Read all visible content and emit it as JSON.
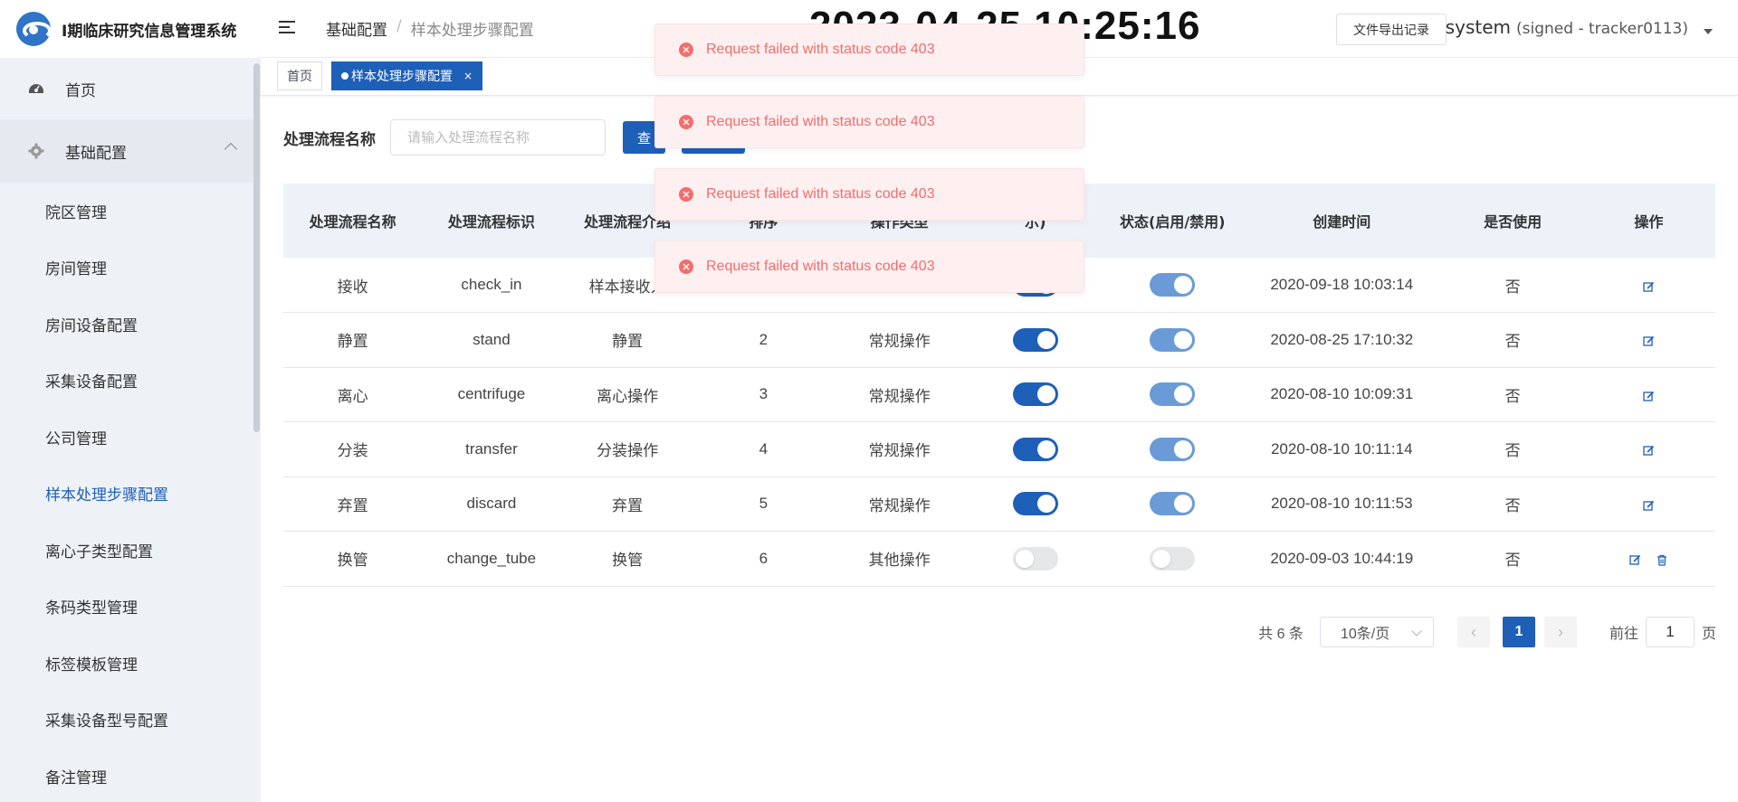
{
  "app": {
    "title": "I期临床研究信息管理系统"
  },
  "sidebar": {
    "home": "首页",
    "group": "基础配置",
    "items": [
      {
        "label": "院区管理"
      },
      {
        "label": "房间管理"
      },
      {
        "label": "房间设备配置"
      },
      {
        "label": "采集设备配置"
      },
      {
        "label": "公司管理"
      },
      {
        "label": "样本处理步骤配置",
        "active": true
      },
      {
        "label": "离心子类型配置"
      },
      {
        "label": "条码类型管理"
      },
      {
        "label": "标签模板管理"
      },
      {
        "label": "采集设备型号配置"
      },
      {
        "label": "备注管理"
      }
    ]
  },
  "header": {
    "breadcrumb": [
      "基础配置",
      "样本处理步骤配置"
    ],
    "breadcrumb_sep": "/",
    "clock": "2023-04-25 10:25:16",
    "export_button": "文件导出记录",
    "user": "system",
    "user_detail": "(signed - tracker0113)"
  },
  "tabs": {
    "home": "首页",
    "active": "样本处理步骤配置",
    "close": "×"
  },
  "filter": {
    "label": "处理流程名称",
    "placeholder": "请输入处理流程名称",
    "query_button": "查",
    "second_button": ""
  },
  "table": {
    "headers": [
      "处理流程名称",
      "处理流程标识",
      "处理流程介绍",
      "排序",
      "操作类型",
      "示)",
      "状态(启用/禁用)",
      "创建时间",
      "是否使用",
      "操作"
    ],
    "rows": [
      {
        "name": "接收",
        "code": "check_in",
        "intro": "样本接收入",
        "sort": "",
        "type": "",
        "display": "on",
        "status": "on",
        "created": "2020-09-18 10:03:14",
        "used": "否",
        "delete": false
      },
      {
        "name": "静置",
        "code": "stand",
        "intro": "静置",
        "sort": "2",
        "type": "常规操作",
        "display": "on",
        "status": "on",
        "created": "2020-08-25 17:10:32",
        "used": "否",
        "delete": false
      },
      {
        "name": "离心",
        "code": "centrifuge",
        "intro": "离心操作",
        "sort": "3",
        "type": "常规操作",
        "display": "on",
        "status": "on",
        "created": "2020-08-10 10:09:31",
        "used": "否",
        "delete": false
      },
      {
        "name": "分装",
        "code": "transfer",
        "intro": "分装操作",
        "sort": "4",
        "type": "常规操作",
        "display": "on",
        "status": "on",
        "created": "2020-08-10 10:11:14",
        "used": "否",
        "delete": false
      },
      {
        "name": "弃置",
        "code": "discard",
        "intro": "弃置",
        "sort": "5",
        "type": "常规操作",
        "display": "on",
        "status": "on",
        "created": "2020-08-10 10:11:53",
        "used": "否",
        "delete": false
      },
      {
        "name": "换管",
        "code": "change_tube",
        "intro": "换管",
        "sort": "6",
        "type": "其他操作",
        "display": "off",
        "status": "off",
        "created": "2020-09-03 10:44:19",
        "used": "否",
        "delete": true
      }
    ]
  },
  "pagination": {
    "total": "共 6 条",
    "page_size": "10条/页",
    "current_page": "1",
    "goto_label": "前往",
    "goto_value": "1",
    "goto_suffix": "页"
  },
  "toasts": [
    {
      "message": "Request failed with status code 403"
    },
    {
      "message": "Request failed with status code 403"
    },
    {
      "message": "Request failed with status code 403"
    },
    {
      "message": "Request failed with status code 403"
    }
  ],
  "colors": {
    "primary": "#1e5fb8",
    "switch_light": "#6a9bd6",
    "error": "#f56c6c",
    "error_bg": "#fef0f0",
    "sidebar_bg": "#eef1f6"
  }
}
